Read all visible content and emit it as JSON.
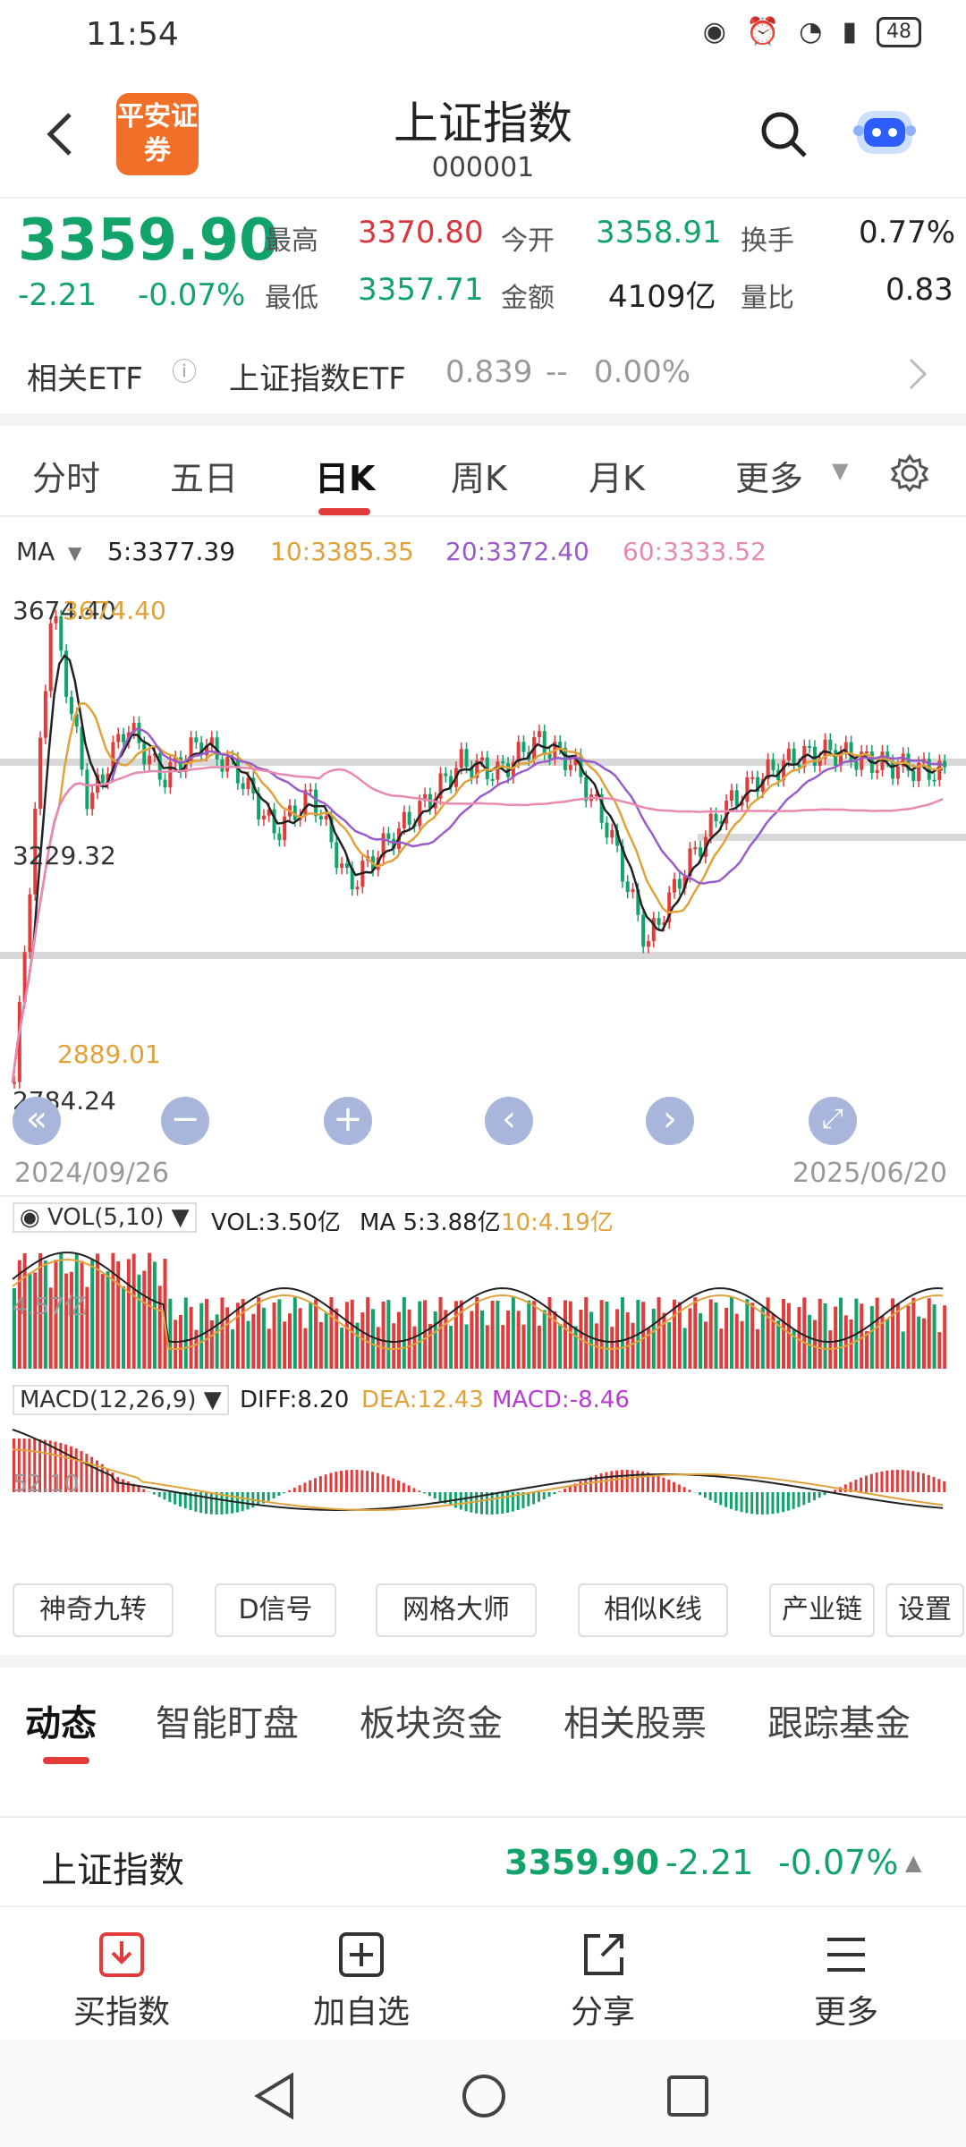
{
  "status": {
    "time": "11:54",
    "battery": "48"
  },
  "header": {
    "logo": "平安证券",
    "title": "上证指数",
    "code": "000001"
  },
  "quote": {
    "price": "3359.90",
    "change": "-2.21",
    "change_pct": "-0.07%",
    "high_label": "最高",
    "high": "3370.80",
    "open_label": "今开",
    "open": "3358.91",
    "turnover_label": "换手",
    "turnover": "0.77%",
    "low_label": "最低",
    "low": "3357.71",
    "amount_label": "金额",
    "amount": "4109亿",
    "ratio_label": "量比",
    "ratio": "0.83"
  },
  "etf": {
    "label": "相关ETF",
    "name": "上证指数ETF",
    "price": "0.839",
    "chg": "--",
    "pct": "0.00%"
  },
  "tabs": [
    "分时",
    "五日",
    "日K",
    "周K",
    "月K",
    "更多"
  ],
  "ma": {
    "label": "MA",
    "items": [
      "5:3377.39",
      "10:3385.35",
      "20:3372.40",
      "60:3333.52"
    ],
    "colors": [
      "#222222",
      "#e0a23a",
      "#9a5cc8",
      "#e889b0"
    ]
  },
  "chart_labels": {
    "high1": "3674.40",
    "high2": "3674.40",
    "mid": "3229.32",
    "low1": "2889.01",
    "low2": "2784.24"
  },
  "dates": {
    "start": "2024/09/26",
    "end": "2025/06/20"
  },
  "vol": {
    "label": "VOL(5,10)",
    "vol": "VOL:3.50亿",
    "ma5": "MA 5:3.88亿",
    "ma10": "10:4.19亿",
    "axis": "4.57亿"
  },
  "macd": {
    "label": "MACD(12,26,9)",
    "diff": "DIFF:8.20",
    "dea": "DEA:12.43",
    "macd": "MACD:-8.46",
    "axis": "52.10"
  },
  "tools": [
    "神奇九转",
    "D信号",
    "网格大师",
    "相似K线",
    "产业链",
    "设置"
  ],
  "tabs2": [
    "动态",
    "智能盯盘",
    "板块资金",
    "相关股票",
    "跟踪基金"
  ],
  "row": {
    "name": "上证指数",
    "price": "3359.90",
    "change": "-2.21",
    "pct": "-0.07%"
  },
  "bottom": [
    "买指数",
    "加自选",
    "分享",
    "更多"
  ],
  "chart_data": {
    "type": "candlestick",
    "x_range": [
      "2024/09/26",
      "2025/06/20"
    ],
    "y_labels": [
      "3674.40",
      "3229.32",
      "2889.01",
      "2784.24"
    ],
    "close_trace": [
      2784,
      3674,
      3300,
      3450,
      3350,
      3420,
      3360,
      3250,
      3320,
      3150,
      3230,
      3300,
      3380,
      3360,
      3420,
      3380,
      3250,
      3040,
      3180,
      3290,
      3350,
      3390,
      3400,
      3380,
      3370,
      3360
    ]
  }
}
